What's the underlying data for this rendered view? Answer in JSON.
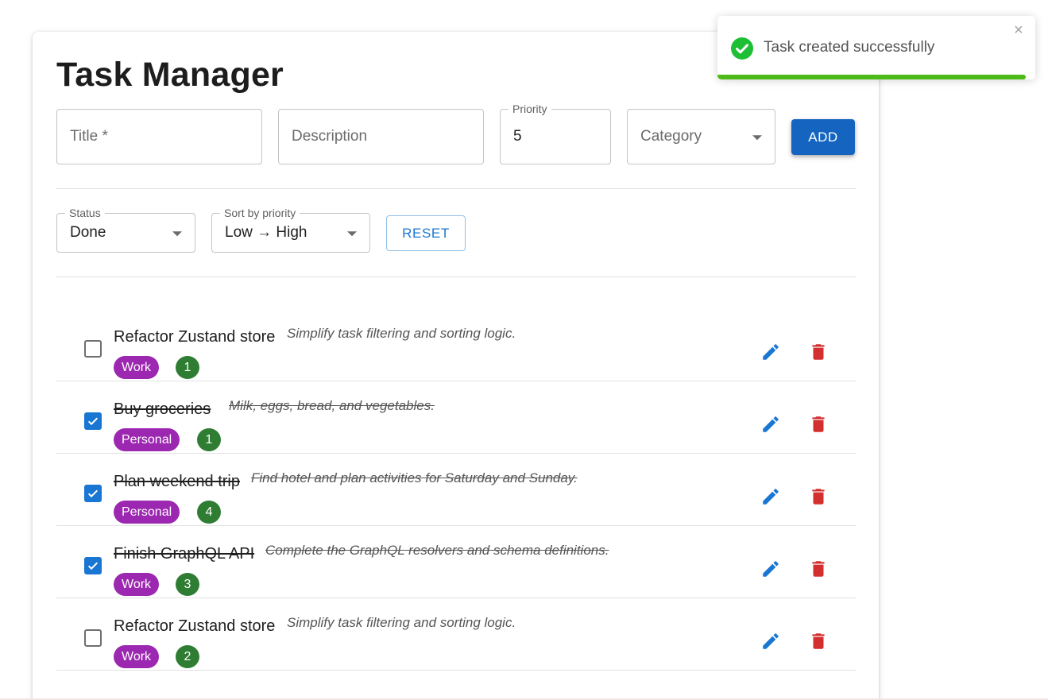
{
  "app": {
    "title": "Task Manager"
  },
  "form": {
    "title_placeholder": "Title *",
    "description_placeholder": "Description",
    "priority_label": "Priority",
    "priority_value": "5",
    "category_placeholder": "Category",
    "add_label": "ADD"
  },
  "filters": {
    "status_label": "Status",
    "status_value": "Done",
    "sort_label": "Sort by priority",
    "sort_value": "Low → High",
    "reset_label": "RESET"
  },
  "tasks": [
    {
      "title": "Refactor Zustand store",
      "description": "Simplify task filtering and sorting logic.",
      "category": "Work",
      "priority": "1",
      "completed": false
    },
    {
      "title": "Buy groceries",
      "description": "Milk, eggs, bread, and vegetables.",
      "category": "Personal",
      "priority": "1",
      "completed": true
    },
    {
      "title": "Plan weekend trip",
      "description": "Find hotel and plan activities for Saturday and Sunday.",
      "category": "Personal",
      "priority": "4",
      "completed": true
    },
    {
      "title": "Finish GraphQL API",
      "description": "Complete the GraphQL resolvers and schema definitions.",
      "category": "Work",
      "priority": "3",
      "completed": true
    },
    {
      "title": "Refactor Zustand store",
      "description": "Simplify task filtering and sorting logic.",
      "category": "Work",
      "priority": "2",
      "completed": false
    }
  ],
  "icons": {
    "edit": "pencil-icon",
    "delete": "trash-icon",
    "toast_status": "check-circle-icon",
    "toast_close": "close-icon"
  },
  "colors": {
    "primary": "#1976d2",
    "add_button": "#1565c0",
    "category_chip": "#9c27b0",
    "priority_chip": "#2e7d32",
    "delete": "#d32f2f",
    "success": "#4cbb17"
  },
  "toast": {
    "message": "Task created successfully",
    "close_symbol": "×",
    "progress": 0.97
  }
}
